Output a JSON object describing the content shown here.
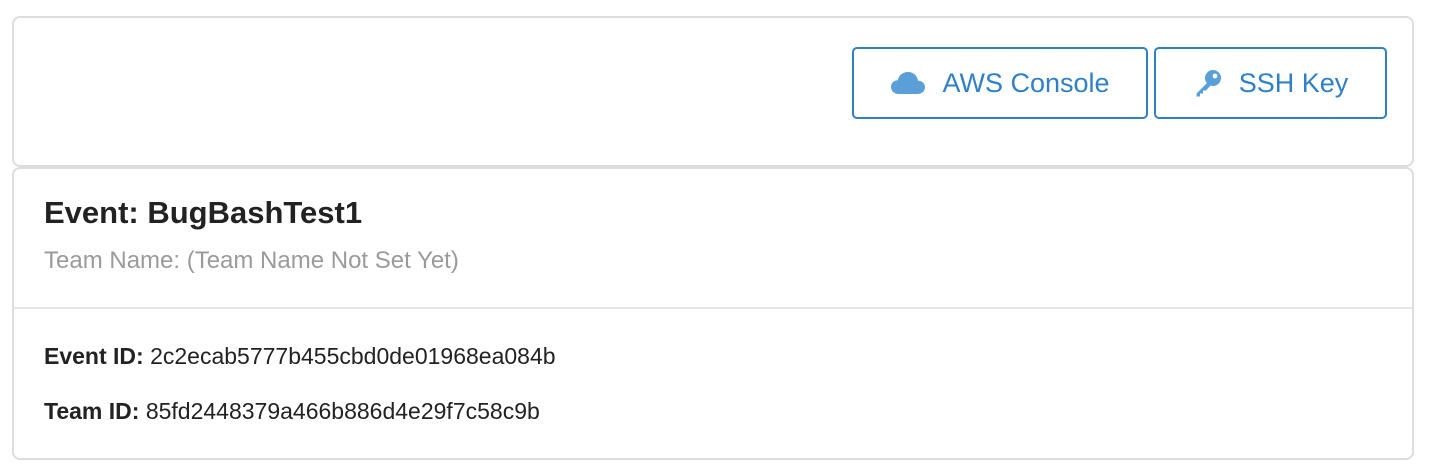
{
  "toolbar": {
    "aws_console_label": "AWS Console",
    "ssh_key_label": "SSH Key",
    "aws_icon": "cloud-icon",
    "ssh_icon": "key-icon"
  },
  "event": {
    "title": "Event: BugBashTest1",
    "team_name": "Team Name: (Team Name Not Set Yet)",
    "event_id_label": "Event ID:",
    "event_id_value": "2c2ecab5777b455cbd0de01968ea084b",
    "team_id_label": "Team ID:",
    "team_id_value": "85fd2448379a466b886d4e29f7c58c9b"
  },
  "colors": {
    "accent": "#2f80c7",
    "icon": "#5b9fd9",
    "muted_text": "#9a9a9a",
    "border": "#dddddd"
  }
}
